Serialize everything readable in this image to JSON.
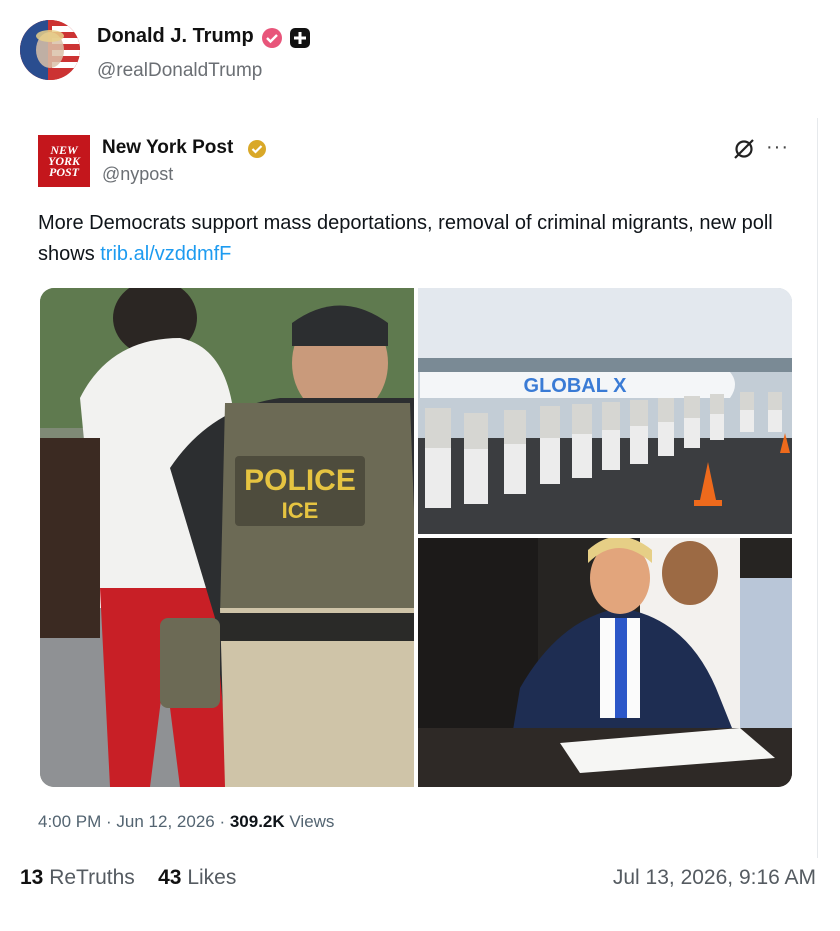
{
  "post": {
    "author_name": "Donald J. Trump",
    "author_handle": "@realDonaldTrump",
    "avatar_icon": "flag-portrait-avatar",
    "verified_icon": "verified-badge-icon",
    "plus_icon": "plus-badge-icon"
  },
  "embed": {
    "logo_lines": [
      "NEW",
      "YORK",
      "POST"
    ],
    "name": "New York Post",
    "handle": "@nypost",
    "badge_icon": "gold-verified-icon",
    "text": "More Democrats support mass deportations, removal of criminal migrants, new poll shows ",
    "link": "trib.al/vzddmfF",
    "images": {
      "vest_line1": "POLICE",
      "vest_line2": "ICE",
      "plane_text": "GLOBAL X"
    },
    "time": "4:00 PM · Jun 12, 2026 · ",
    "views": "309.2K",
    "views_label": " Views"
  },
  "stats": {
    "retruths_count": "13",
    "retruths_label": " ReTruths",
    "likes_count": "43",
    "likes_label": " Likes",
    "timestamp": "Jul 13, 2026, 9:16 AM"
  },
  "colors": {
    "link": "#1d9bf0",
    "verified_pink": "#e8557a",
    "nypost_red": "#c4161c",
    "gold": "#d9a828"
  }
}
